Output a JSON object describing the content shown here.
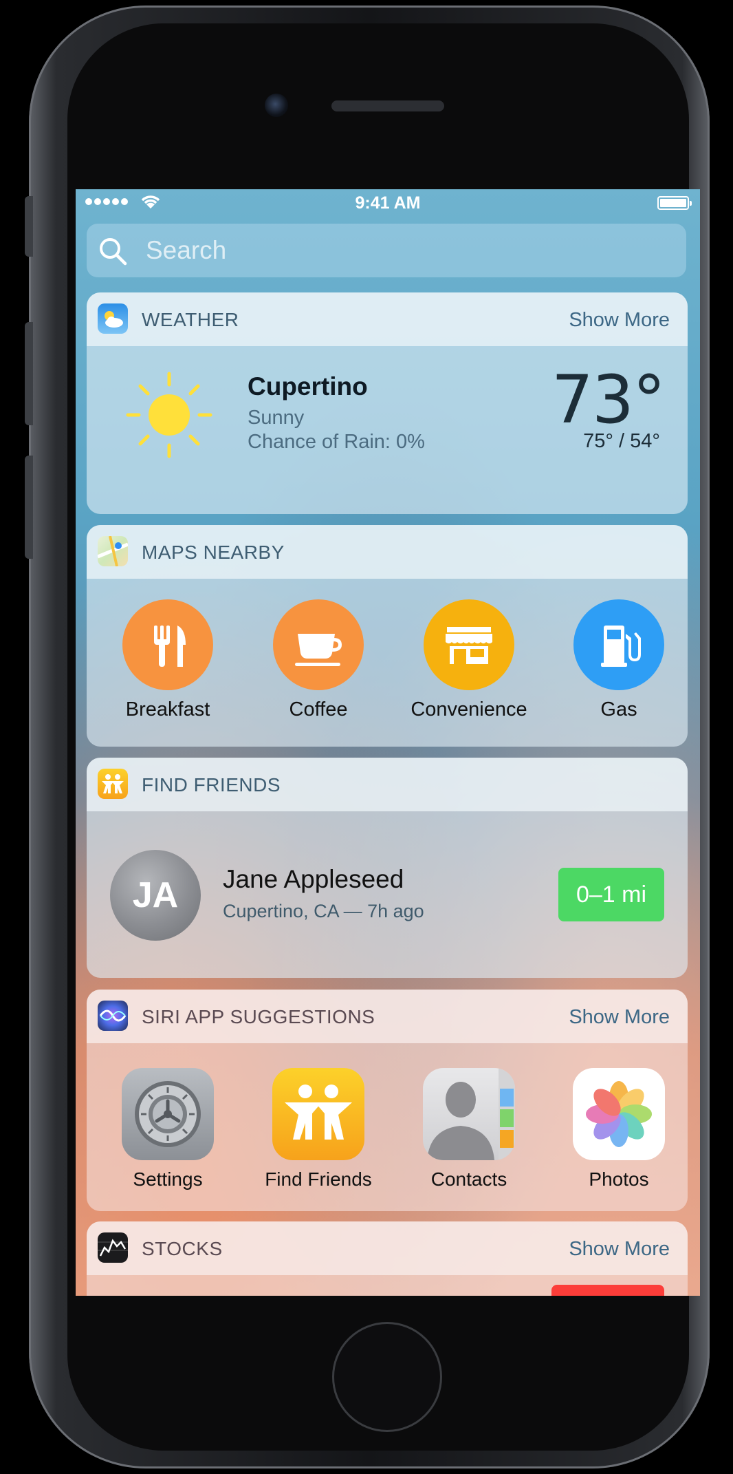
{
  "status_bar": {
    "time": "9:41 AM"
  },
  "search": {
    "placeholder": "Search"
  },
  "weather": {
    "title": "WEATHER",
    "show_more": "Show More",
    "city": "Cupertino",
    "condition": "Sunny",
    "rain": "Chance of Rain: 0%",
    "temp": "73°",
    "hilo": "75° / 54°",
    "icon": "sun-icon"
  },
  "maps": {
    "title": "MAPS NEARBY",
    "items": [
      {
        "label": "Breakfast",
        "icon": "fork-knife-icon",
        "color": "#f7933f"
      },
      {
        "label": "Coffee",
        "icon": "coffee-cup-icon",
        "color": "#f7933f"
      },
      {
        "label": "Convenience",
        "icon": "storefront-icon",
        "color": "#f6b10e"
      },
      {
        "label": "Gas",
        "icon": "gas-pump-icon",
        "color": "#2e9ef5"
      }
    ]
  },
  "friends": {
    "title": "FIND FRIENDS",
    "initials": "JA",
    "name": "Jane Appleseed",
    "location": "Cupertino, CA  —  7h ago",
    "distance": "0–1 mi",
    "distance_color": "#4cd864"
  },
  "siri": {
    "title": "SIRI APP SUGGESTIONS",
    "show_more": "Show More",
    "apps": [
      {
        "label": "Settings",
        "icon": "settings-gear-icon"
      },
      {
        "label": "Find Friends",
        "icon": "find-friends-icon"
      },
      {
        "label": "Contacts",
        "icon": "contacts-icon"
      },
      {
        "label": "Photos",
        "icon": "photos-icon"
      }
    ]
  },
  "stocks": {
    "title": "STOCKS",
    "show_more": "Show More",
    "chip_color": "#fc3d39"
  }
}
